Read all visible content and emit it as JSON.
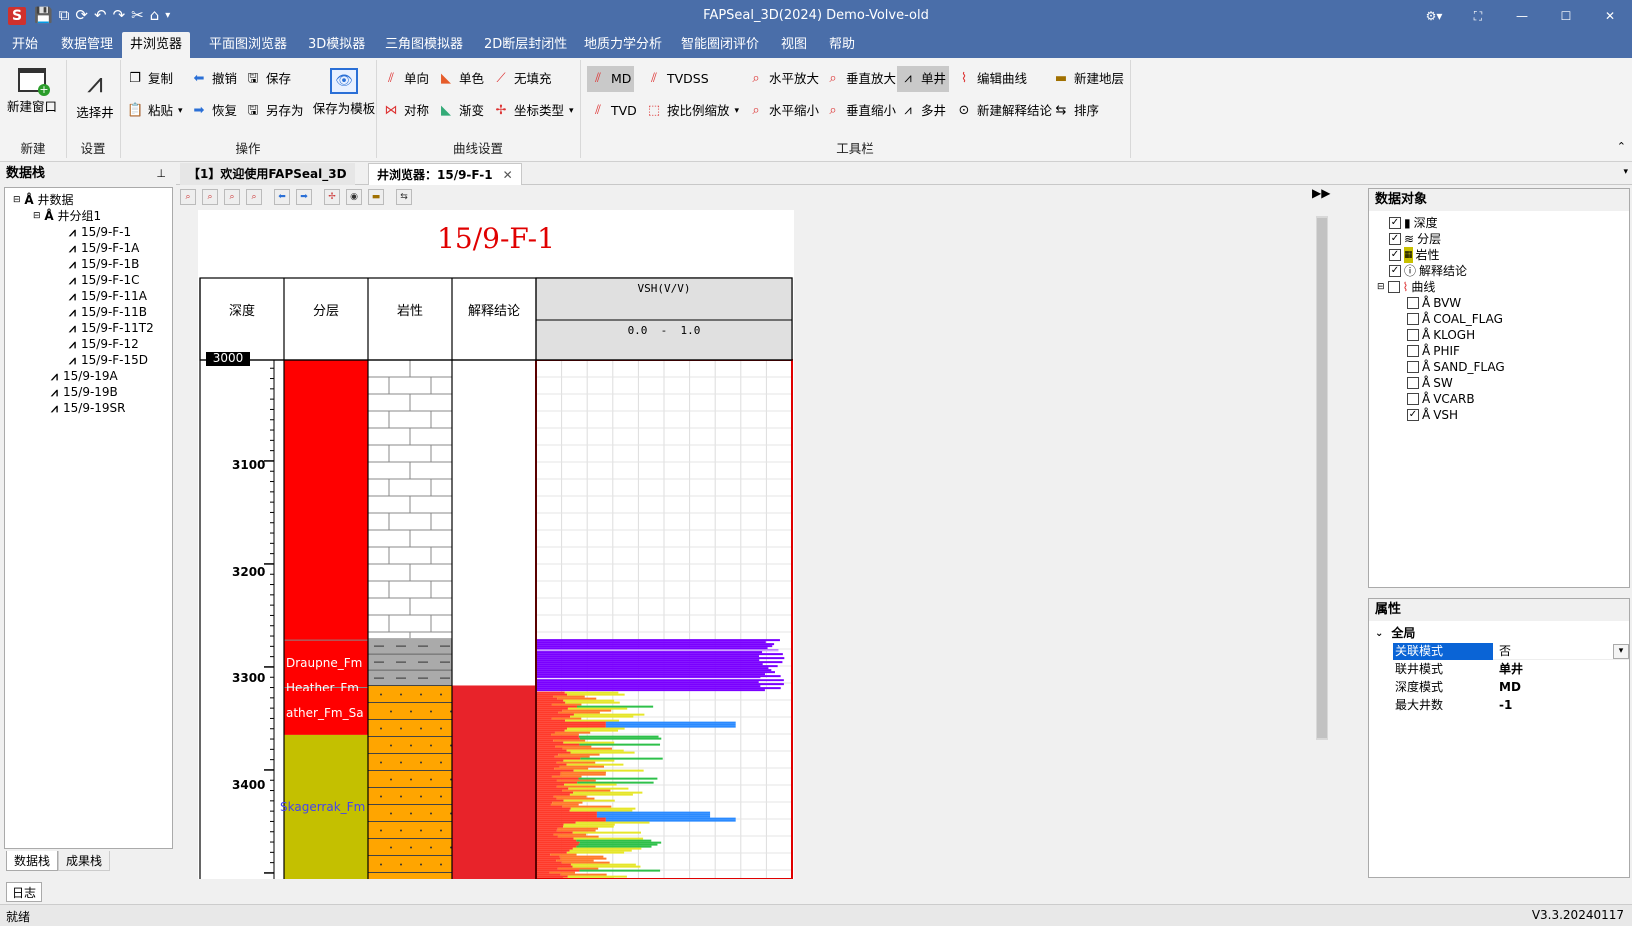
{
  "window": {
    "title": "FAPSeal_3D(2024) Demo-Volve-old"
  },
  "menus": [
    "开始",
    "数据管理",
    "井浏览器",
    "平面图浏览器",
    "3D模拟器",
    "三角图模拟器",
    "2D断层封闭性",
    "地质力学分析",
    "智能圈闭评价",
    "视图",
    "帮助"
  ],
  "ribbon": {
    "new_window": "新建窗口",
    "select_well": "选择井",
    "copy": "复制",
    "undo": "撤销",
    "save": "保存",
    "paste": "粘贴",
    "redo": "恢复",
    "save_as": "另存为",
    "save_template": "保存为模板",
    "single_dir": "单向",
    "single_color": "单色",
    "no_fill": "无填充",
    "symmetric": "对称",
    "gradient": "渐变",
    "coord_type": "坐标类型",
    "md": "MD",
    "tvdss": "TVDSS",
    "tvd": "TVD",
    "scale_zoom": "按比例缩放",
    "h_zoom_in": "水平放大",
    "v_zoom_in": "垂直放大",
    "single_well": "单井",
    "edit_curve": "编辑曲线",
    "new_layer": "新建地层",
    "h_zoom_out": "水平缩小",
    "v_zoom_out": "垂直缩小",
    "multi_well": "多井",
    "new_interp": "新建解释结论",
    "sort": "排序",
    "groups": {
      "new": "新建",
      "settings": "设置",
      "ops": "操作",
      "curve_settings": "曲线设置",
      "toolbar": "工具栏"
    }
  },
  "left_panel": {
    "title": "数据栈",
    "root": "井数据",
    "group": "井分组1",
    "wells_in_group": [
      "15/9-F-1",
      "15/9-F-1A",
      "15/9-F-1B",
      "15/9-F-1C",
      "15/9-F-11A",
      "15/9-F-11B",
      "15/9-F-11T2",
      "15/9-F-12",
      "15/9-F-15D"
    ],
    "wells_other": [
      "15/9-19A",
      "15/9-19B",
      "15/9-19SR"
    ],
    "tabs": [
      "数据栈",
      "成果栈"
    ]
  },
  "doc_tabs": [
    "【1】欢迎使用FAPSeal_3D",
    "井浏览器：15/9-F-1"
  ],
  "well_panel": {
    "well_name": "15/9-F-1",
    "col_depth": "深度",
    "col_layer": "分层",
    "col_lith": "岩性",
    "col_interp": "解释结论",
    "curve_name": "VSH(V/V)",
    "curve_range": "0.0  -  1.0",
    "depth_top_label": "3000",
    "depth_ticks": [
      "3100",
      "3200",
      "3300",
      "3400"
    ],
    "formations": [
      "Draupne_Fm",
      "Heather_Fm",
      "ather_Fm_Sa",
      "Skagerrak_Fm"
    ]
  },
  "right_panel": {
    "title": "数据对象",
    "items": [
      {
        "label": "深度",
        "checked": true
      },
      {
        "label": "分层",
        "checked": true
      },
      {
        "label": "岩性",
        "checked": true
      },
      {
        "label": "解释结论",
        "checked": true
      },
      {
        "label": "曲线",
        "checked": false
      }
    ],
    "curves": [
      {
        "label": "BVW",
        "checked": false
      },
      {
        "label": "COAL_FLAG",
        "checked": false
      },
      {
        "label": "KLOGH",
        "checked": false
      },
      {
        "label": "PHIF",
        "checked": false
      },
      {
        "label": "SAND_FLAG",
        "checked": false
      },
      {
        "label": "SW",
        "checked": false
      },
      {
        "label": "VCARB",
        "checked": false
      },
      {
        "label": "VSH",
        "checked": true
      }
    ]
  },
  "properties": {
    "title": "属性",
    "section": "全局",
    "rows": [
      {
        "key": "关联模式",
        "value": "否"
      },
      {
        "key": "联井模式",
        "value": "单井"
      },
      {
        "key": "深度模式",
        "value": "MD"
      },
      {
        "key": "最大井数",
        "value": "-1"
      }
    ]
  },
  "bottom": {
    "log_tab": "日志",
    "status": "就绪",
    "version": "V3.3.20240117"
  },
  "colors": {
    "title_bar": "#4a6ea9",
    "accent": "#0a64d6",
    "layer_red": "#ff0000",
    "layer_olive": "#c4c000",
    "sand": "#ffa500",
    "interp_red": "#e8232a",
    "vsh_purple": "#7a00ff"
  }
}
